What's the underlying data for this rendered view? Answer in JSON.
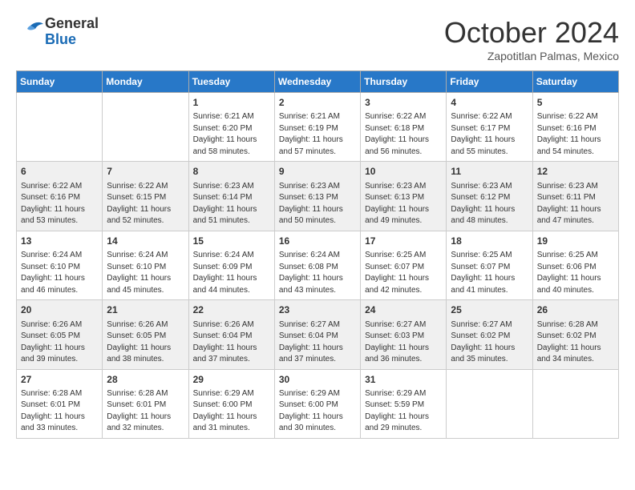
{
  "header": {
    "logo_line1": "General",
    "logo_line2": "Blue",
    "month_title": "October 2024",
    "location": "Zapotitlan Palmas, Mexico"
  },
  "weekdays": [
    "Sunday",
    "Monday",
    "Tuesday",
    "Wednesday",
    "Thursday",
    "Friday",
    "Saturday"
  ],
  "weeks": [
    [
      {
        "day": "",
        "info": ""
      },
      {
        "day": "",
        "info": ""
      },
      {
        "day": "1",
        "info": "Sunrise: 6:21 AM\nSunset: 6:20 PM\nDaylight: 11 hours and 58 minutes."
      },
      {
        "day": "2",
        "info": "Sunrise: 6:21 AM\nSunset: 6:19 PM\nDaylight: 11 hours and 57 minutes."
      },
      {
        "day": "3",
        "info": "Sunrise: 6:22 AM\nSunset: 6:18 PM\nDaylight: 11 hours and 56 minutes."
      },
      {
        "day": "4",
        "info": "Sunrise: 6:22 AM\nSunset: 6:17 PM\nDaylight: 11 hours and 55 minutes."
      },
      {
        "day": "5",
        "info": "Sunrise: 6:22 AM\nSunset: 6:16 PM\nDaylight: 11 hours and 54 minutes."
      }
    ],
    [
      {
        "day": "6",
        "info": "Sunrise: 6:22 AM\nSunset: 6:16 PM\nDaylight: 11 hours and 53 minutes."
      },
      {
        "day": "7",
        "info": "Sunrise: 6:22 AM\nSunset: 6:15 PM\nDaylight: 11 hours and 52 minutes."
      },
      {
        "day": "8",
        "info": "Sunrise: 6:23 AM\nSunset: 6:14 PM\nDaylight: 11 hours and 51 minutes."
      },
      {
        "day": "9",
        "info": "Sunrise: 6:23 AM\nSunset: 6:13 PM\nDaylight: 11 hours and 50 minutes."
      },
      {
        "day": "10",
        "info": "Sunrise: 6:23 AM\nSunset: 6:13 PM\nDaylight: 11 hours and 49 minutes."
      },
      {
        "day": "11",
        "info": "Sunrise: 6:23 AM\nSunset: 6:12 PM\nDaylight: 11 hours and 48 minutes."
      },
      {
        "day": "12",
        "info": "Sunrise: 6:23 AM\nSunset: 6:11 PM\nDaylight: 11 hours and 47 minutes."
      }
    ],
    [
      {
        "day": "13",
        "info": "Sunrise: 6:24 AM\nSunset: 6:10 PM\nDaylight: 11 hours and 46 minutes."
      },
      {
        "day": "14",
        "info": "Sunrise: 6:24 AM\nSunset: 6:10 PM\nDaylight: 11 hours and 45 minutes."
      },
      {
        "day": "15",
        "info": "Sunrise: 6:24 AM\nSunset: 6:09 PM\nDaylight: 11 hours and 44 minutes."
      },
      {
        "day": "16",
        "info": "Sunrise: 6:24 AM\nSunset: 6:08 PM\nDaylight: 11 hours and 43 minutes."
      },
      {
        "day": "17",
        "info": "Sunrise: 6:25 AM\nSunset: 6:07 PM\nDaylight: 11 hours and 42 minutes."
      },
      {
        "day": "18",
        "info": "Sunrise: 6:25 AM\nSunset: 6:07 PM\nDaylight: 11 hours and 41 minutes."
      },
      {
        "day": "19",
        "info": "Sunrise: 6:25 AM\nSunset: 6:06 PM\nDaylight: 11 hours and 40 minutes."
      }
    ],
    [
      {
        "day": "20",
        "info": "Sunrise: 6:26 AM\nSunset: 6:05 PM\nDaylight: 11 hours and 39 minutes."
      },
      {
        "day": "21",
        "info": "Sunrise: 6:26 AM\nSunset: 6:05 PM\nDaylight: 11 hours and 38 minutes."
      },
      {
        "day": "22",
        "info": "Sunrise: 6:26 AM\nSunset: 6:04 PM\nDaylight: 11 hours and 37 minutes."
      },
      {
        "day": "23",
        "info": "Sunrise: 6:27 AM\nSunset: 6:04 PM\nDaylight: 11 hours and 37 minutes."
      },
      {
        "day": "24",
        "info": "Sunrise: 6:27 AM\nSunset: 6:03 PM\nDaylight: 11 hours and 36 minutes."
      },
      {
        "day": "25",
        "info": "Sunrise: 6:27 AM\nSunset: 6:02 PM\nDaylight: 11 hours and 35 minutes."
      },
      {
        "day": "26",
        "info": "Sunrise: 6:28 AM\nSunset: 6:02 PM\nDaylight: 11 hours and 34 minutes."
      }
    ],
    [
      {
        "day": "27",
        "info": "Sunrise: 6:28 AM\nSunset: 6:01 PM\nDaylight: 11 hours and 33 minutes."
      },
      {
        "day": "28",
        "info": "Sunrise: 6:28 AM\nSunset: 6:01 PM\nDaylight: 11 hours and 32 minutes."
      },
      {
        "day": "29",
        "info": "Sunrise: 6:29 AM\nSunset: 6:00 PM\nDaylight: 11 hours and 31 minutes."
      },
      {
        "day": "30",
        "info": "Sunrise: 6:29 AM\nSunset: 6:00 PM\nDaylight: 11 hours and 30 minutes."
      },
      {
        "day": "31",
        "info": "Sunrise: 6:29 AM\nSunset: 5:59 PM\nDaylight: 11 hours and 29 minutes."
      },
      {
        "day": "",
        "info": ""
      },
      {
        "day": "",
        "info": ""
      }
    ]
  ]
}
